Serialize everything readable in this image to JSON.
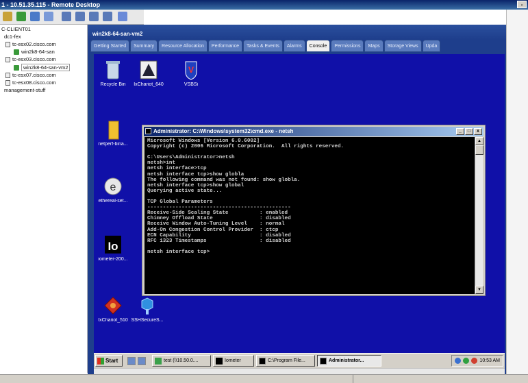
{
  "remote_desktop": {
    "title": "1 - 10.51.35.115 - Remote Desktop"
  },
  "inventory": {
    "items": [
      {
        "label": "C-CLIENT01"
      },
      {
        "label": "dc1-fex"
      },
      {
        "label": "tc-esx02.cisco.com"
      },
      {
        "label": "win2k8-64-san"
      },
      {
        "label": "tc-esx03.cisco.com"
      },
      {
        "label": "win2k8-64-san-vm2"
      },
      {
        "label": "tc-esx07.cisco.com"
      },
      {
        "label": "tc-esx08.cisco.com"
      },
      {
        "label": "management-stuff"
      }
    ]
  },
  "vm": {
    "name": "win2k8-64-san-vm2",
    "tabs": [
      {
        "label": "Getting Started"
      },
      {
        "label": "Summary"
      },
      {
        "label": "Resource Allocation"
      },
      {
        "label": "Performance"
      },
      {
        "label": "Tasks & Events"
      },
      {
        "label": "Alarms"
      },
      {
        "label": "Console"
      },
      {
        "label": "Permissions"
      },
      {
        "label": "Maps"
      },
      {
        "label": "Storage Views"
      },
      {
        "label": "Upda"
      }
    ],
    "active_tab": "Console"
  },
  "desktop": {
    "icons": [
      {
        "label": "Recycle Bin",
        "icon": "recycle-bin-icon"
      },
      {
        "label": "IxChariot_640",
        "icon": "ixchariot-icon"
      },
      {
        "label": "VSBSi",
        "icon": "vsbsi-shield-icon"
      },
      {
        "label": "netperf-bina...",
        "icon": "folder-icon"
      },
      {
        "label": "ethereal-set...",
        "icon": "ethereal-icon"
      },
      {
        "label": "iometer-200...",
        "icon": "iometer-icon"
      },
      {
        "label": "IxChariot_510",
        "icon": "ixchariot510-icon"
      },
      {
        "label": "SSHSecureS...",
        "icon": "ssh-icon"
      }
    ]
  },
  "cmd_window": {
    "title": "Administrator: C:\\Windows\\system32\\cmd.exe - netsh",
    "lines": [
      "Microsoft Windows [Version 6.0.6002]",
      "Copyright (c) 2006 Microsoft Corporation.  All rights reserved.",
      "",
      "C:\\Users\\Administrator>netsh",
      "netsh>int",
      "netsh interface>tcp",
      "netsh interface tcp>show globla",
      "The following command was not found: show globla.",
      "netsh interface tcp>show global",
      "Querying active state...",
      "",
      "TCP Global Parameters",
      "----------------------------------------------",
      "Receive-Side Scaling State          : enabled",
      "Chimney Offload State               : disabled",
      "Receive Window Auto-Tuning Level    : normal",
      "Add-On Congestion Control Provider  : ctcp",
      "ECN Capability                      : disabled",
      "RFC 1323 Timestamps                 : disabled",
      "",
      "netsh interface tcp>"
    ]
  },
  "taskbar": {
    "start_label": "Start",
    "tasks": [
      {
        "label": "test (\\\\10.50.0....",
        "active": false
      },
      {
        "label": "Iometer",
        "active": false
      },
      {
        "label": "C:\\Program File...",
        "active": false
      },
      {
        "label": "Administrator...",
        "active": true
      }
    ],
    "clock": "10:53 AM"
  },
  "colors": {
    "desktop_bg": "#1010a8",
    "vm_frame": "#1e3e8c",
    "title_gradient_start": "#0a246a",
    "title_gradient_end": "#a6caf0"
  }
}
